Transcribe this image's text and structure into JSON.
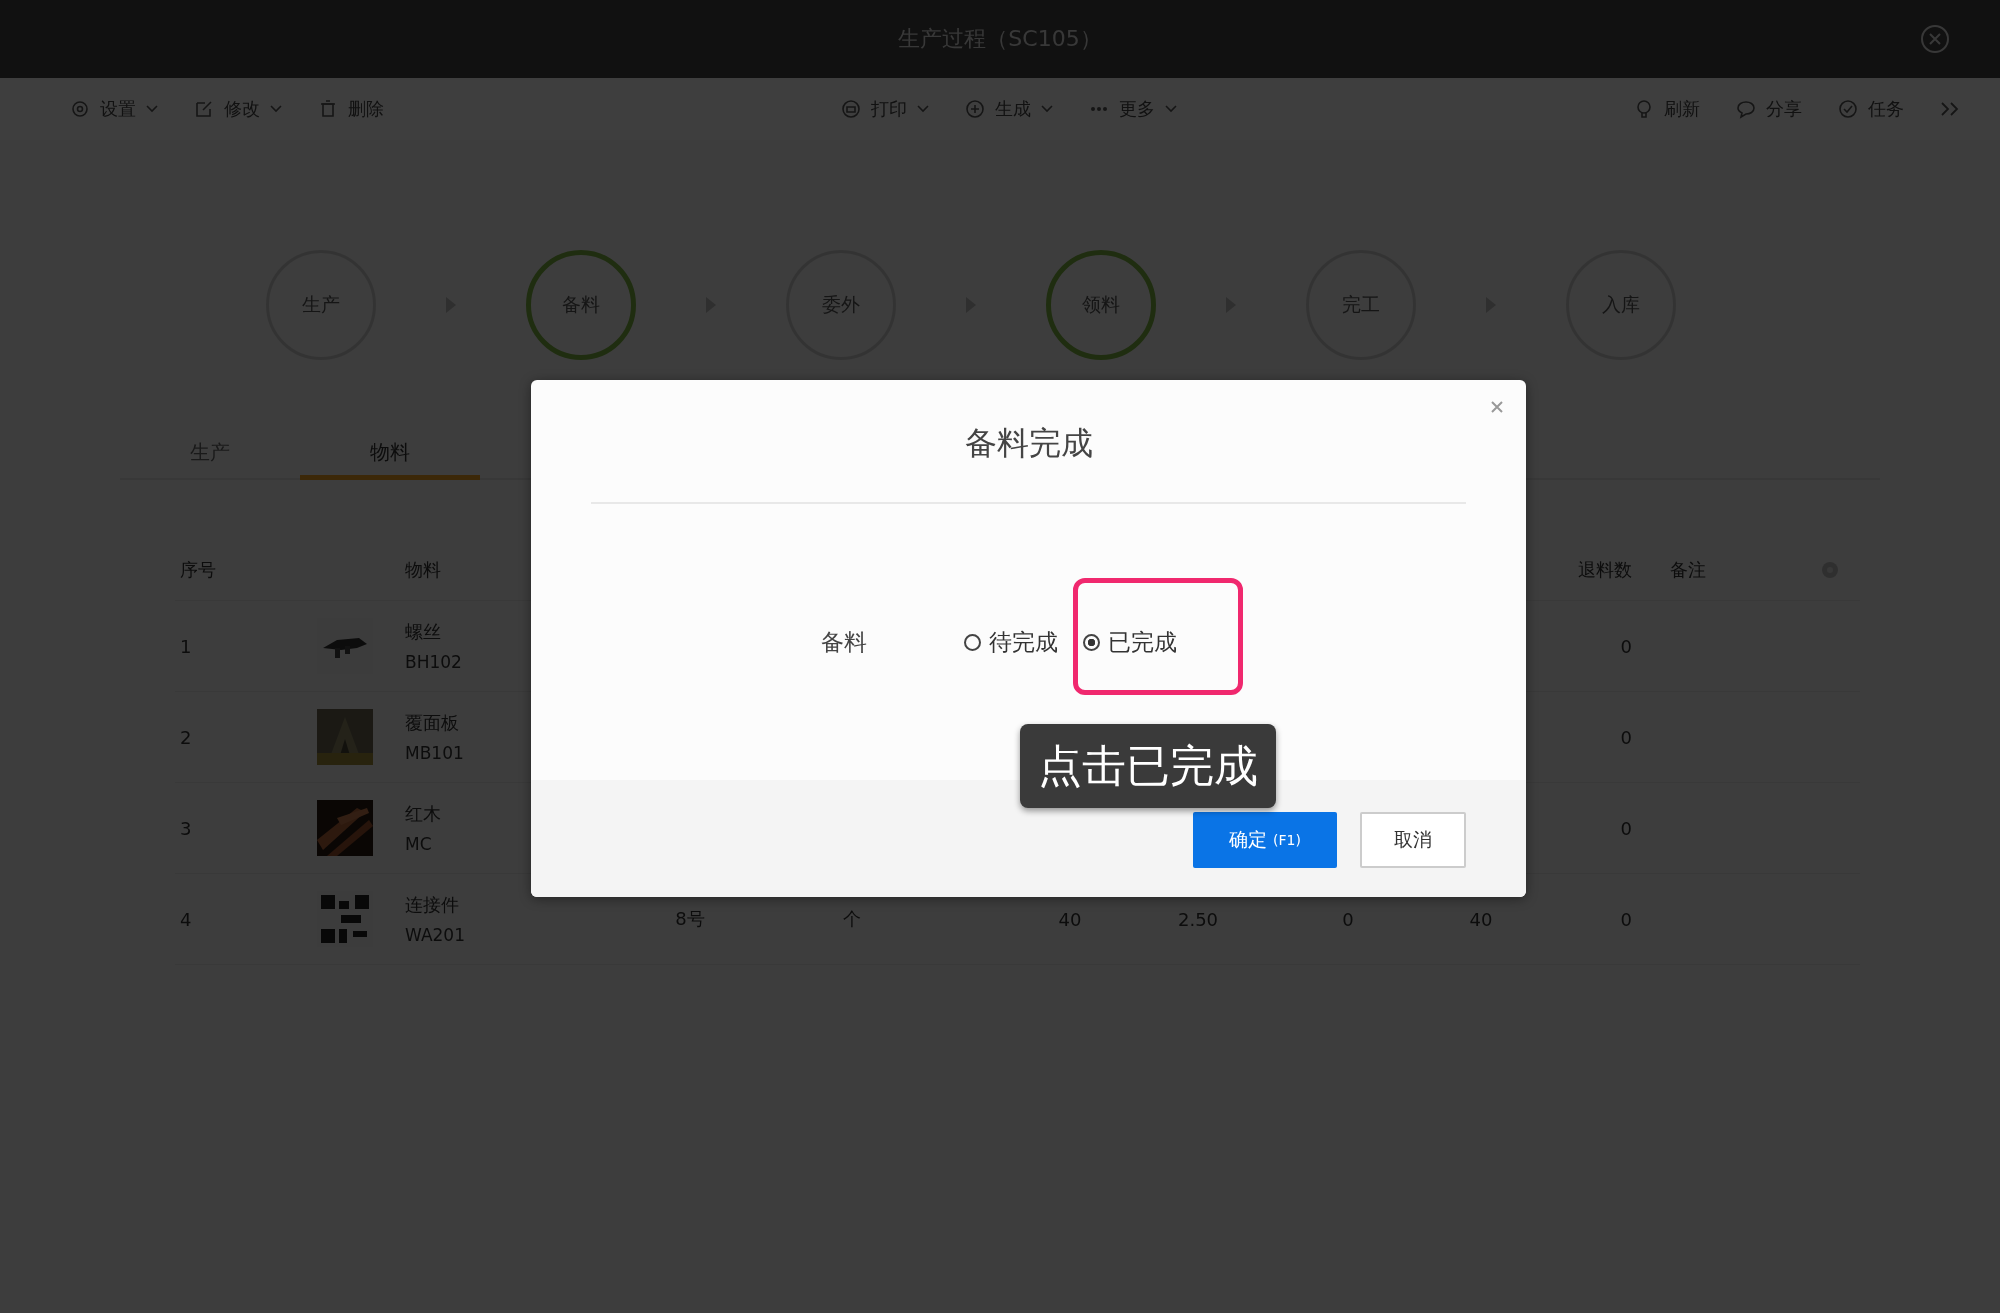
{
  "window": {
    "title": "生产过程（SC105）"
  },
  "toolbar": {
    "left": [
      {
        "label": "设置",
        "dropdown": true
      },
      {
        "label": "修改",
        "dropdown": true
      },
      {
        "label": "删除",
        "dropdown": false
      }
    ],
    "center": [
      {
        "label": "打印",
        "dropdown": true
      },
      {
        "label": "生成",
        "dropdown": true
      },
      {
        "label": "更多",
        "dropdown": true
      }
    ],
    "right": [
      {
        "label": "刷新",
        "dropdown": false
      },
      {
        "label": "分享",
        "dropdown": false
      },
      {
        "label": "任务",
        "dropdown": false
      }
    ]
  },
  "steps": [
    {
      "label": "生产",
      "done": false
    },
    {
      "label": "备料",
      "done": true
    },
    {
      "label": "委外",
      "done": false
    },
    {
      "label": "领料",
      "done": true
    },
    {
      "label": "完工",
      "done": false
    },
    {
      "label": "入库",
      "done": false
    }
  ],
  "tabs": [
    {
      "label": "生产",
      "selected": false
    },
    {
      "label": "物料",
      "selected": true
    }
  ],
  "table": {
    "columns": {
      "seq": "序号",
      "material": "物料",
      "returned": "退料数",
      "note": "备注"
    },
    "rows": [
      {
        "seq": "1",
        "name": "螺丝",
        "code": "BH102",
        "returned": "0"
      },
      {
        "seq": "2",
        "name": "覆面板",
        "code": "MB101",
        "returned": "0"
      },
      {
        "seq": "3",
        "name": "红木",
        "code": "MC",
        "returned": "0"
      },
      {
        "seq": "4",
        "name": "连接件",
        "code": "WA201",
        "column_4": "8号",
        "column_5": "个",
        "column_6": "40",
        "column_7": "2.50",
        "column_8": "0",
        "column_9": "40",
        "returned": "0"
      }
    ]
  },
  "dialog": {
    "title": "备料完成",
    "field_label": "备料",
    "options": [
      {
        "label": "待完成",
        "selected": false
      },
      {
        "label": "已完成",
        "selected": true
      }
    ],
    "confirm": "确定",
    "confirm_shortcut": "(F1)",
    "cancel": "取消"
  },
  "annotation": {
    "text": "点击已完成"
  }
}
